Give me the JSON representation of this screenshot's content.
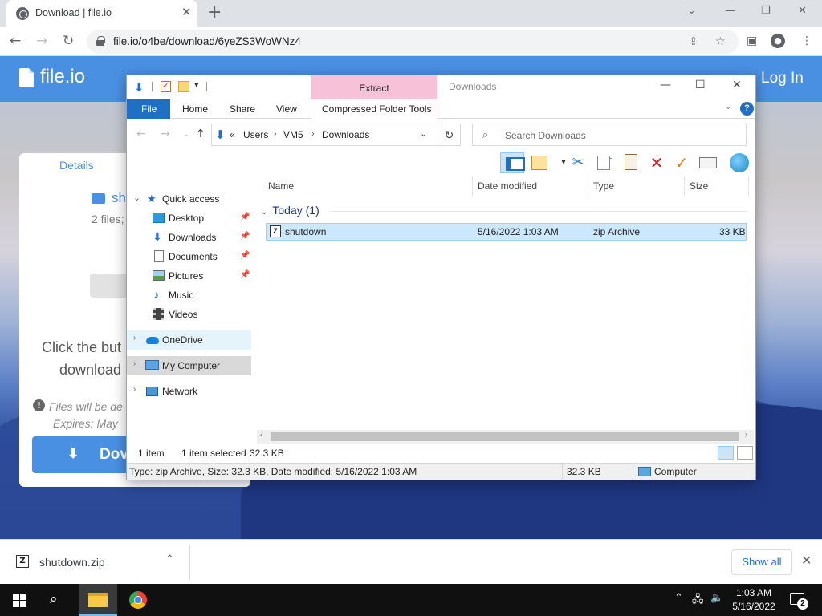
{
  "browser": {
    "tab_title": "Download | file.io",
    "tab_close": "✕",
    "new_tab": "+",
    "url": "file.io/o4be/download/6yeZS3WoWNz4",
    "window_controls": [
      "⌄",
      "—",
      "❐",
      "✕"
    ]
  },
  "site": {
    "logo": "file.io",
    "login": "Log In",
    "card": {
      "details_tab": "Details",
      "folder_name": "sh",
      "file_count": "2 files;",
      "click_text_1": "Click the but",
      "click_text_2": "download",
      "info_line_1": "Files will be de",
      "info_line_2": "Expires: May",
      "download_button": "Dov"
    }
  },
  "explorer": {
    "title": "Downloads",
    "extract_tab": "Extract",
    "ribbon_tabs": [
      "File",
      "Home",
      "Share",
      "View",
      "Compressed Folder Tools"
    ],
    "address": {
      "overflow": "«",
      "crumbs": [
        "Users",
        "VM5",
        "Downloads"
      ]
    },
    "search_placeholder": "Search Downloads",
    "nav": {
      "quick_access": "Quick access",
      "items": [
        "Desktop",
        "Downloads",
        "Documents",
        "Pictures",
        "Music",
        "Videos"
      ],
      "onedrive": "OneDrive",
      "my_computer": "My Computer",
      "network": "Network"
    },
    "columns": [
      "Name",
      "Date modified",
      "Type",
      "Size"
    ],
    "group": "Today (1)",
    "file": {
      "name": "shutdown",
      "date": "5/16/2022 1:03 AM",
      "type": "zip Archive",
      "size": "33 KB"
    },
    "status": {
      "items": "1 item",
      "selected": "1 item selected",
      "selected_size": "32.3 KB",
      "detail": "Type: zip Archive, Size: 32.3 KB, Date modified: 5/16/2022 1:03 AM",
      "size": "32.3 KB",
      "location": "Computer"
    }
  },
  "download_bar": {
    "file_name": "shutdown.zip",
    "show_all": "Show all"
  },
  "taskbar": {
    "time": "1:03 AM",
    "date": "5/16/2022",
    "notification_count": "2"
  }
}
